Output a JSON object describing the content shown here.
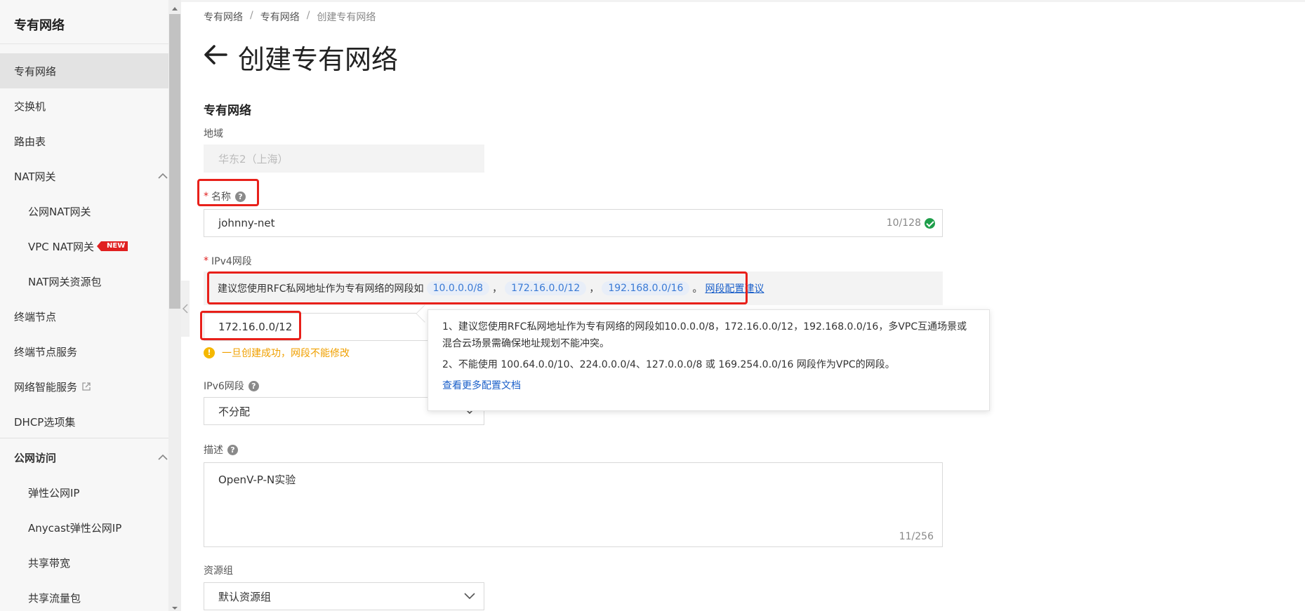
{
  "sidebar": {
    "title": "专有网络",
    "items": [
      {
        "label": "专有网络"
      },
      {
        "label": "交换机"
      },
      {
        "label": "路由表"
      },
      {
        "label": "NAT网关"
      },
      {
        "label": "公网NAT网关"
      },
      {
        "label": "VPC NAT网关",
        "badge": "NEW"
      },
      {
        "label": "NAT网关资源包"
      },
      {
        "label": "终端节点"
      },
      {
        "label": "终端节点服务"
      },
      {
        "label": "网络智能服务"
      },
      {
        "label": "DHCP选项集"
      },
      {
        "label": "公网访问"
      },
      {
        "label": "弹性公网IP"
      },
      {
        "label": "Anycast弹性公网IP"
      },
      {
        "label": "共享带宽"
      },
      {
        "label": "共享流量包"
      }
    ]
  },
  "breadcrumb": [
    "专有网络",
    "专有网络",
    "创建专有网络"
  ],
  "page": {
    "title": "创建专有网络"
  },
  "form": {
    "section_title": "专有网络",
    "region": {
      "label": "地域",
      "value": "华东2（上海）"
    },
    "name": {
      "required_mark": "*",
      "label": "名称",
      "value": "johnny-net",
      "counter": "10/128"
    },
    "ipv4": {
      "required_mark": "*",
      "label": "IPv4网段",
      "hint_prefix": "建议您使用RFC私网地址作为专有网络的网段如",
      "cidrs": [
        "10.0.0.0/8",
        "172.16.0.0/12",
        "192.168.0.0/16"
      ],
      "comma": "，",
      "period": "。",
      "hint_link": "网段配置建议",
      "value": "172.16.0.0/12",
      "warning": "一旦创建成功，网段不能修改"
    },
    "ipv6": {
      "label": "IPv6网段",
      "value": "不分配"
    },
    "description": {
      "label": "描述",
      "value": "OpenV-P-N实验",
      "counter": "11/256"
    },
    "resource_group": {
      "label": "资源组",
      "value": "默认资源组"
    }
  },
  "popover": {
    "line1": "1、建议您使用RFC私网地址作为专有网络的网段如10.0.0.0/8，172.16.0.0/12，192.168.0.0/16，多VPC互通场景或混合云场景需确保地址规划不能冲突。",
    "line2": "2、不能使用 100.64.0.0/10、224.0.0.0/4、127.0.0.0/8 或 169.254.0.0/16 网段作为VPC的网段。",
    "link": "查看更多配置文档"
  },
  "colors": {
    "accent": "#ff6a00",
    "highlight_box": "#e8201a",
    "link": "#1a5fc9",
    "warning": "#f0a000",
    "success": "#1e9e4a"
  }
}
